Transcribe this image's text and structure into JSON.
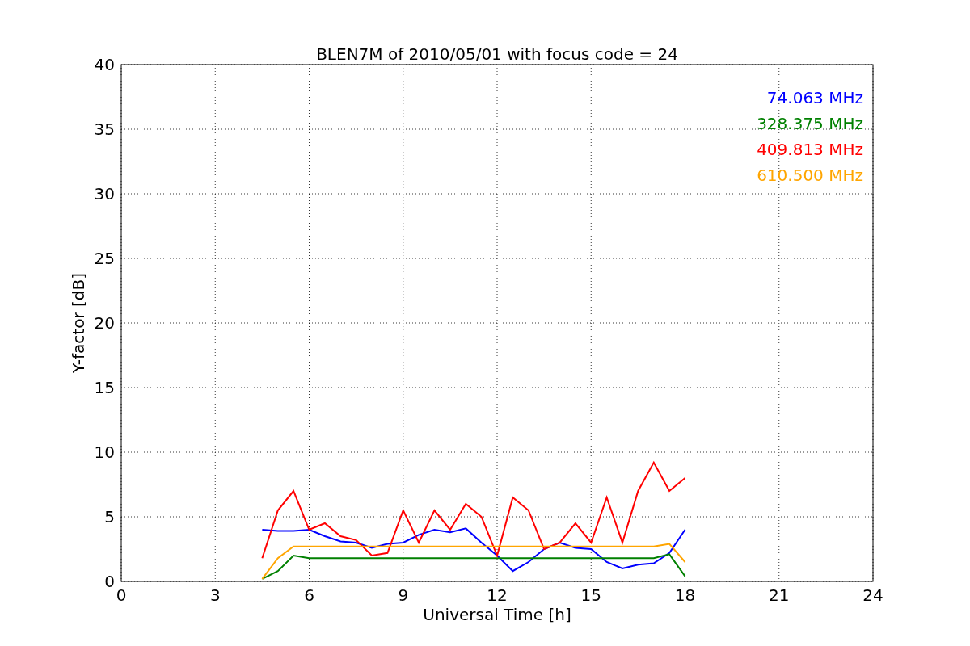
{
  "figure": {
    "chart_data": {
      "type": "line",
      "title": "BLEN7M of 2010/05/01 with focus code = 24",
      "xlabel": "Universal Time [h]",
      "ylabel": "Y-factor [dB]",
      "x": [
        4.5,
        5,
        5.5,
        6,
        6.5,
        7,
        7.5,
        8,
        8.5,
        9,
        9.5,
        10,
        10.5,
        11,
        11.5,
        12,
        12.5,
        13,
        13.5,
        14,
        14.5,
        15,
        15.5,
        16,
        16.5,
        17,
        17.5,
        18
      ],
      "series": [
        {
          "name": "74.063 MHz",
          "color": "#0000ff",
          "values": [
            4.0,
            3.9,
            3.9,
            4.0,
            3.5,
            3.1,
            3.0,
            2.6,
            2.9,
            3.0,
            3.6,
            4.0,
            3.8,
            4.1,
            3.0,
            2.0,
            0.8,
            1.5,
            2.5,
            3.0,
            2.6,
            2.5,
            1.5,
            1.0,
            1.3,
            1.4,
            2.2,
            4.0
          ]
        },
        {
          "name": "328.375 MHz",
          "color": "#008000",
          "values": [
            0.2,
            0.8,
            2.0,
            1.8,
            1.8,
            1.8,
            1.8,
            1.8,
            1.8,
            1.8,
            1.8,
            1.8,
            1.8,
            1.8,
            1.8,
            1.8,
            1.8,
            1.8,
            1.8,
            1.8,
            1.8,
            1.8,
            1.8,
            1.8,
            1.8,
            1.8,
            2.1,
            0.4
          ]
        },
        {
          "name": "409.813 MHz",
          "color": "#ff0000",
          "values": [
            1.8,
            5.5,
            7.0,
            4.0,
            4.5,
            3.5,
            3.2,
            2.0,
            2.2,
            5.5,
            3.0,
            5.5,
            4.0,
            6.0,
            5.0,
            2.0,
            6.5,
            5.5,
            2.5,
            3.0,
            4.5,
            3.0,
            6.5,
            3.0,
            7.0,
            9.2,
            7.0,
            8.0
          ]
        },
        {
          "name": "610.500 MHz",
          "color": "#ffa500",
          "values": [
            0.2,
            1.8,
            2.7,
            2.7,
            2.7,
            2.7,
            2.7,
            2.7,
            2.7,
            2.7,
            2.7,
            2.7,
            2.7,
            2.7,
            2.7,
            2.7,
            2.7,
            2.7,
            2.7,
            2.7,
            2.7,
            2.7,
            2.7,
            2.7,
            2.7,
            2.7,
            2.9,
            1.5
          ]
        }
      ],
      "grid": true,
      "xlim": [
        0,
        24
      ],
      "ylim": [
        0,
        40
      ],
      "xticks": [
        0,
        3,
        6,
        9,
        12,
        15,
        18,
        21,
        24
      ],
      "yticks": [
        0,
        5,
        10,
        15,
        20,
        25,
        30,
        35,
        40
      ]
    }
  }
}
